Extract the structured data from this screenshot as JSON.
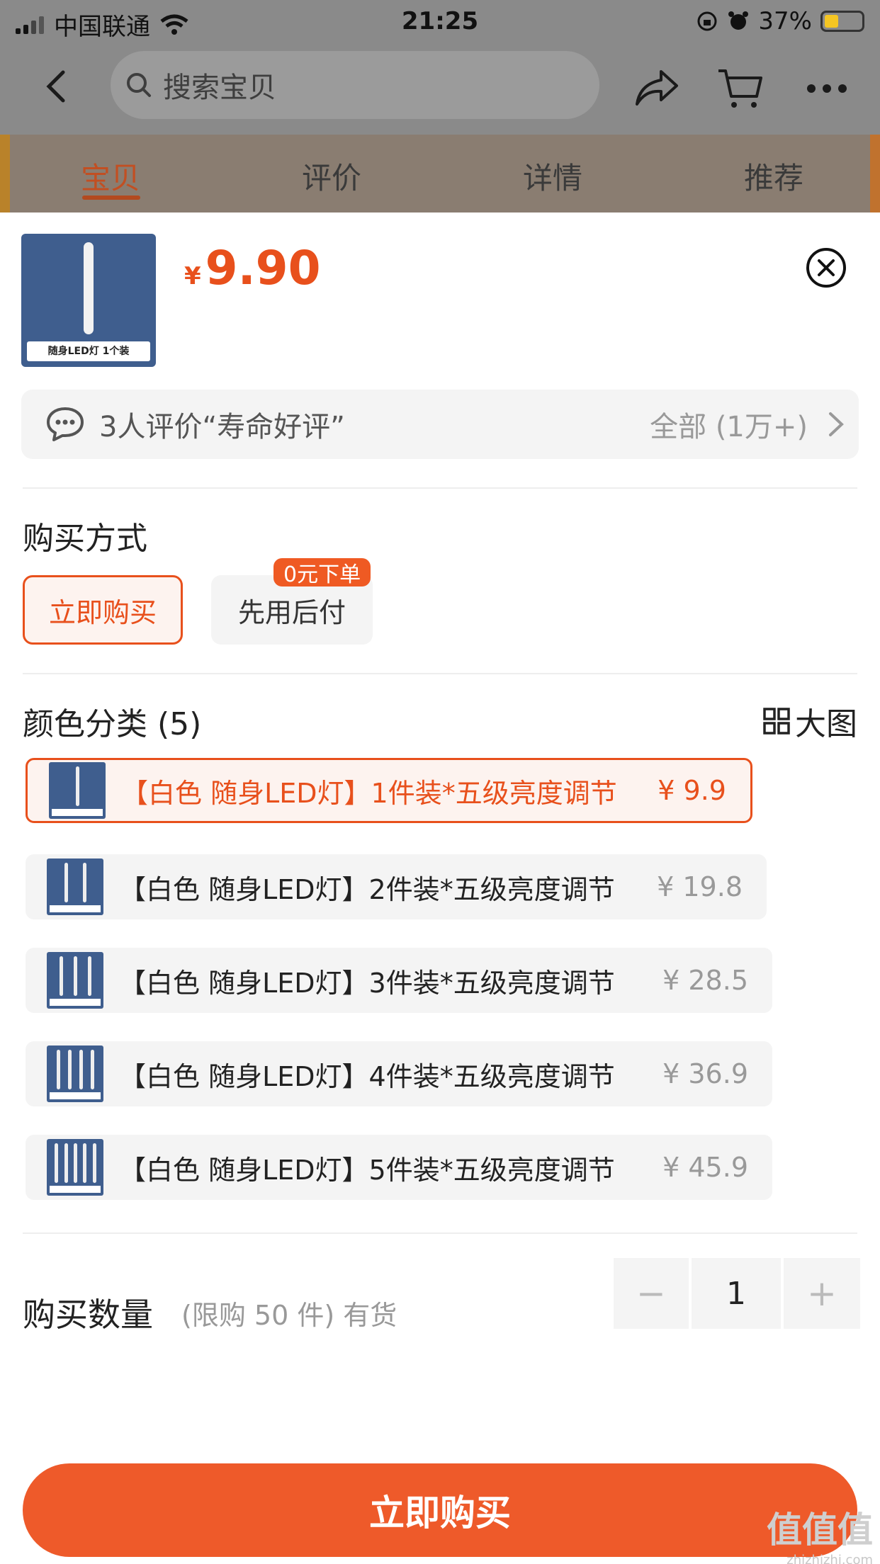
{
  "status_bar": {
    "carrier": "中国联通",
    "time": "21:25",
    "battery": "37%",
    "battery_level": 0.37
  },
  "nav": {
    "search_placeholder": "搜索宝贝",
    "icons": [
      "back-icon",
      "search-icon",
      "share-icon",
      "cart-icon",
      "more-icon"
    ]
  },
  "tabs": [
    {
      "label": "宝贝",
      "active": true
    },
    {
      "label": "评价",
      "active": false
    },
    {
      "label": "详情",
      "active": false
    },
    {
      "label": "推荐",
      "active": false
    }
  ],
  "product": {
    "thumb_caption": "随身LED灯 1个装",
    "currency": "¥",
    "price": "9.90"
  },
  "review": {
    "text": "3人评价“寿命好评”",
    "all_label": "全部 (1万+)"
  },
  "purchase_method": {
    "title": "购买方式",
    "buy_now": "立即购买",
    "pay_later": "先用后付",
    "badge": "0元下单"
  },
  "color": {
    "title": "颜色分类 (5)",
    "big_image_label": "大图",
    "variants": [
      {
        "label": "【白色 随身LED灯】1件装*五级亮度调节",
        "price": "¥ 9.9",
        "selected": true,
        "count": 1
      },
      {
        "label": "【白色 随身LED灯】2件装*五级亮度调节",
        "price": "¥ 19.8",
        "selected": false,
        "count": 2
      },
      {
        "label": "【白色 随身LED灯】3件装*五级亮度调节",
        "price": "¥ 28.5",
        "selected": false,
        "count": 3
      },
      {
        "label": "【白色 随身LED灯】4件装*五级亮度调节",
        "price": "¥ 36.9",
        "selected": false,
        "count": 4
      },
      {
        "label": "【白色 随身LED灯】5件装*五级亮度调节",
        "price": "¥ 45.9",
        "selected": false,
        "count": 5
      }
    ]
  },
  "quantity": {
    "title": "购买数量",
    "note": "(限购 50 件) 有货",
    "minus": "−",
    "value": "1",
    "plus": "+"
  },
  "buy_button": "立即购买",
  "watermark": {
    "big": "值值值",
    "small": "zhizhizhi.com"
  },
  "colors": {
    "accent": "#e8501c",
    "button": "#ee5a2a"
  }
}
